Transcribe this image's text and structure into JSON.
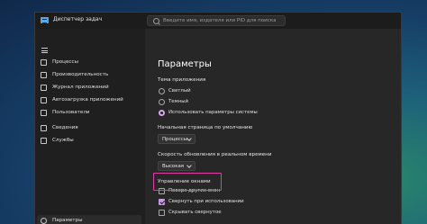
{
  "window": {
    "title": "Диспетчер задач"
  },
  "search": {
    "placeholder": "Введите имя, издателя или PID для поиска"
  },
  "sidebar": {
    "items": [
      {
        "label": "Процессы",
        "icon": "processes-icon"
      },
      {
        "label": "Производительность",
        "icon": "performance-icon"
      },
      {
        "label": "Журнал приложений",
        "icon": "app-history-icon"
      },
      {
        "label": "Автозагрузка приложений",
        "icon": "startup-apps-icon"
      },
      {
        "label": "Пользователи",
        "icon": "users-icon"
      },
      {
        "label": "Сведения",
        "icon": "details-icon"
      },
      {
        "label": "Службы",
        "icon": "services-icon"
      }
    ],
    "settings": {
      "label": "Параметры",
      "icon": "gear-icon"
    }
  },
  "settings_page": {
    "title": "Параметры",
    "theme": {
      "label": "Тема приложения",
      "options": [
        "Светлый",
        "Темный",
        "Использовать параметры системы"
      ],
      "selected": "Использовать параметры системы"
    },
    "start_page": {
      "label": "Начальная страница по умолчанию",
      "value": "Процессы"
    },
    "refresh_rate": {
      "label": "Скорость обновления в реальном времени",
      "value": "Высокая"
    },
    "window_management": {
      "label": "Управление окнами",
      "options": [
        {
          "label": "Поверх других окон",
          "checked": false
        },
        {
          "label": "Свернуть при использовании",
          "checked": true
        },
        {
          "label": "Скрывать свернутое",
          "checked": false
        }
      ]
    }
  },
  "colors": {
    "accent": "#c99be6",
    "highlight": "#e23aa8",
    "background": "#1f1f1f"
  }
}
